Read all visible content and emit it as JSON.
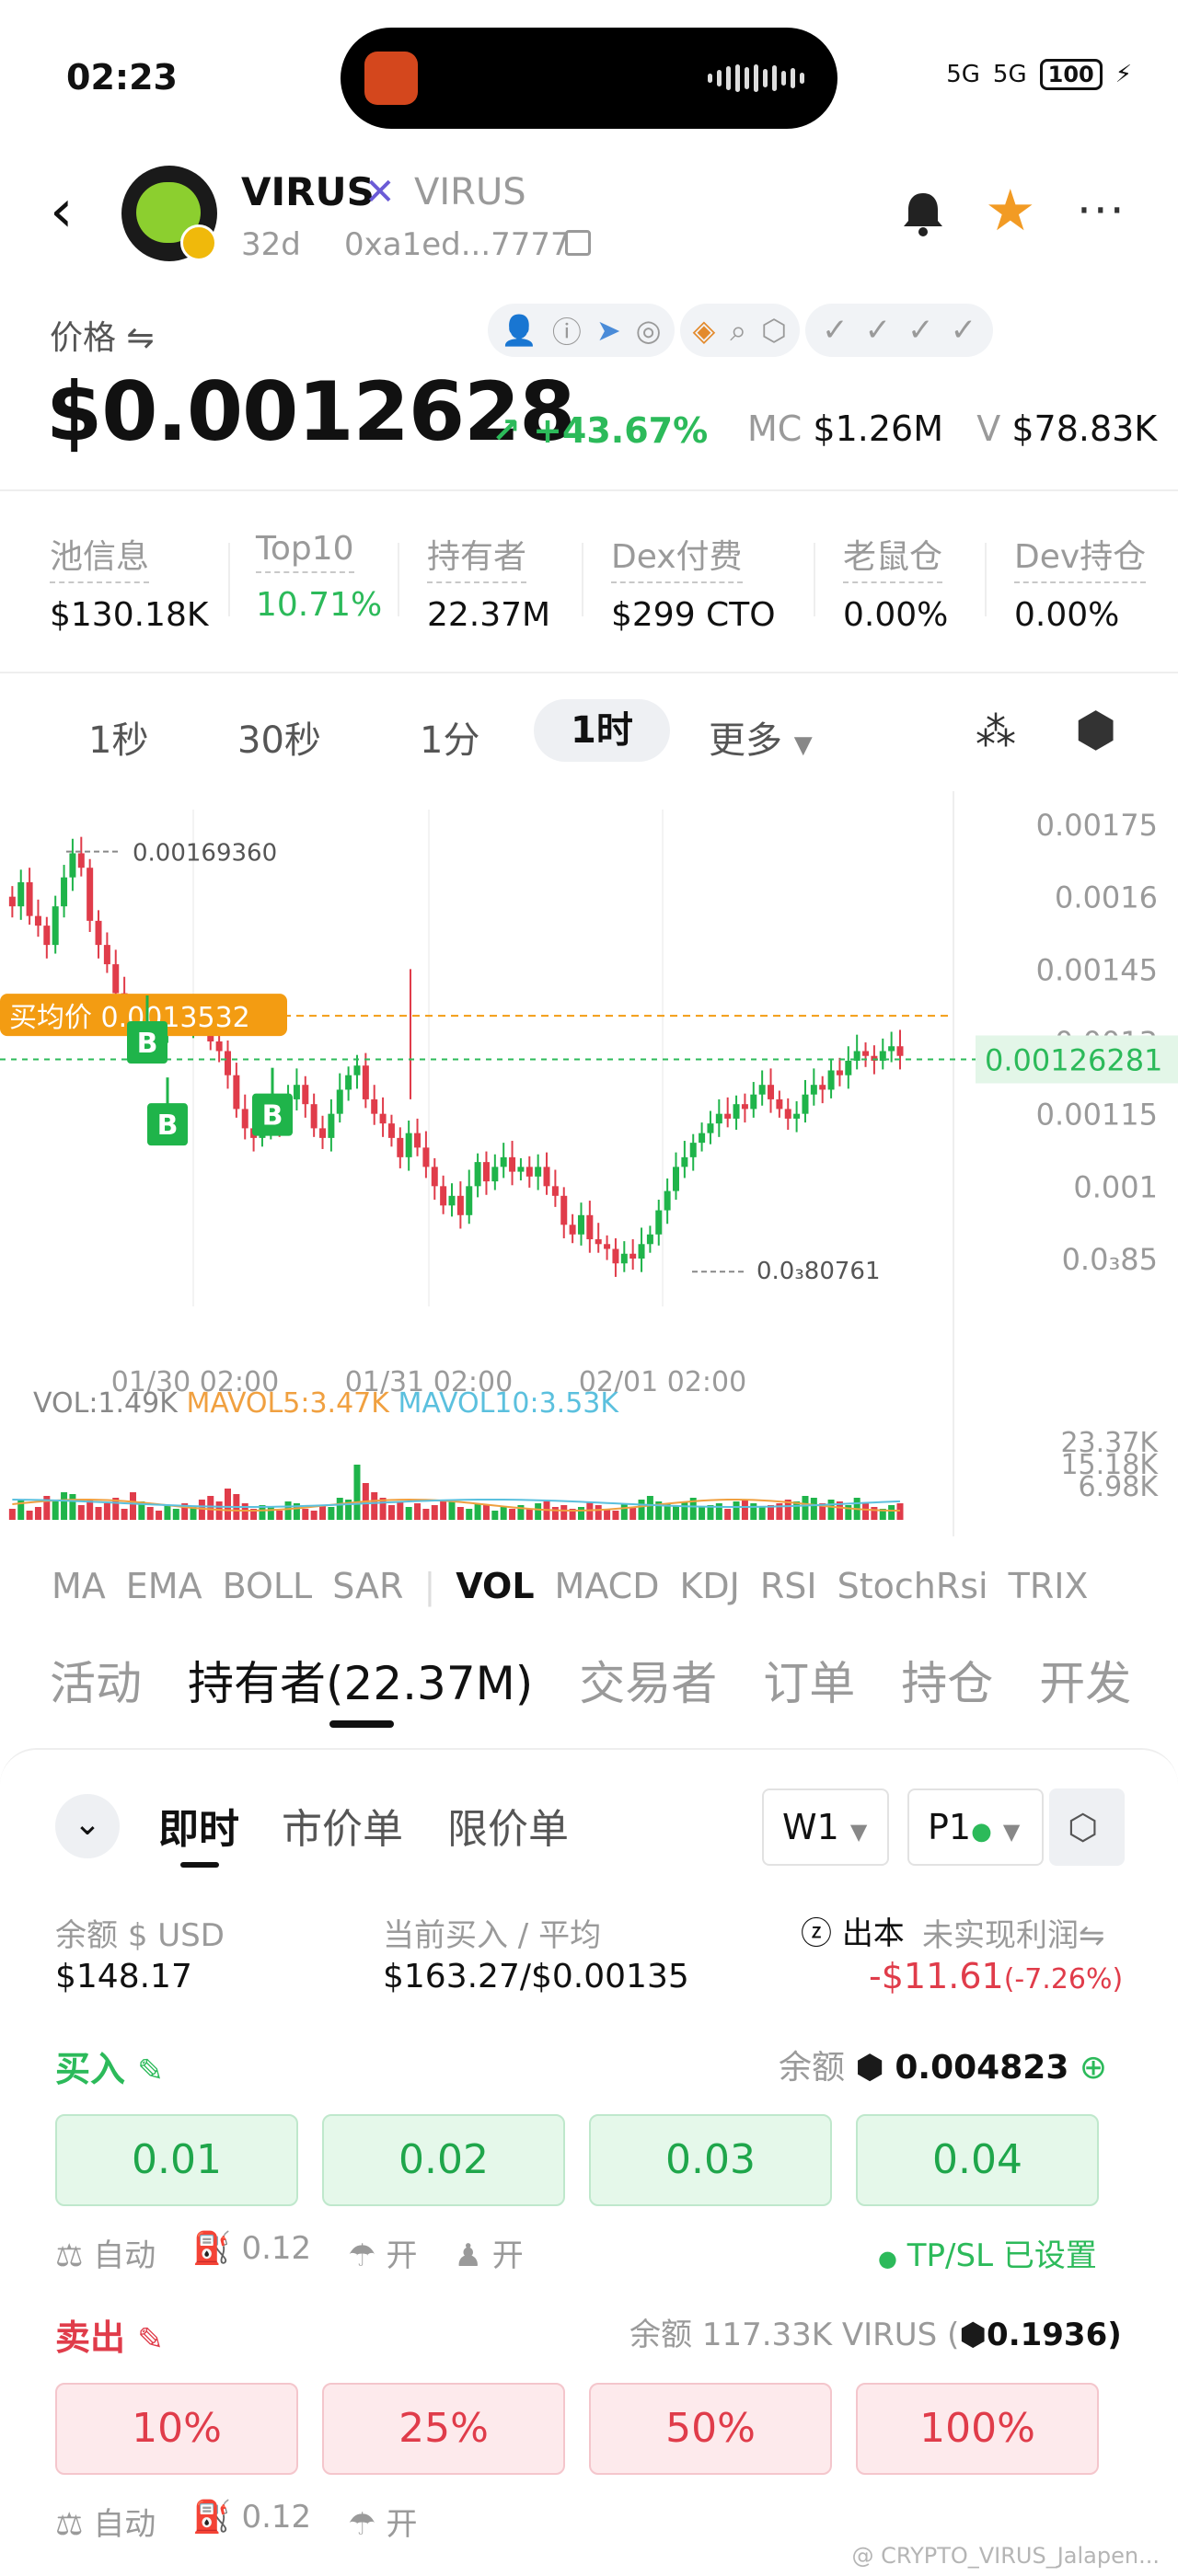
{
  "status": {
    "time": "02:23",
    "signal1": "5G",
    "signal2": "5G",
    "battery": "100"
  },
  "header": {
    "token_name": "VIRUS",
    "token_symbol": "VIRUS",
    "age": "32d",
    "address": "0xa1ed...7777"
  },
  "price": {
    "label": "价格 ⇋",
    "value": "$0.0012628",
    "change": "↗ +43.67%",
    "mc_label": "MC",
    "mc_value": "$1.26M",
    "v_label": "V",
    "v_value": "$78.83K"
  },
  "stats": [
    {
      "label": "池信息",
      "value": "$130.18K"
    },
    {
      "label": "Top10",
      "value": "10.71%"
    },
    {
      "label": "持有者",
      "value": "22.37M"
    },
    {
      "label": "Dex付费",
      "value": "$299 CTO"
    },
    {
      "label": "老鼠仓",
      "value": "0.00%"
    },
    {
      "label": "Dev持仓",
      "value": "0.00%"
    }
  ],
  "timeframes": {
    "s1": "1秒",
    "s30": "30秒",
    "m1": "1分",
    "h1": "1时",
    "more": "更多"
  },
  "chart": {
    "y_ticks": [
      "0.00175",
      "0.0016",
      "0.00145",
      "0.0013",
      "0.00115",
      "0.001",
      "0.0₃85"
    ],
    "x_ticks": [
      "01/30 02:00",
      "01/31 02:00",
      "02/01 02:00"
    ],
    "high_label": "0.00169360",
    "low_label": "0.0₃80761",
    "avg_label": "买均价 0.0013532",
    "current_label": "0.00126281",
    "vol_label": "VOL:1.49K",
    "mavol5_label": "MAVOL5:3.47K",
    "mavol10_label": "MAVOL10:3.53K",
    "vol_ticks": [
      "23.37K",
      "15.18K",
      "6.98K"
    ],
    "buy_marker": "B",
    "colors": {
      "up": "#1fb44a",
      "down": "#e03c4a",
      "avg": "#f39c12",
      "current": "#2cba5a",
      "ma5": "#f0a040",
      "ma10": "#5bc0de"
    }
  },
  "indicators": [
    "MA",
    "EMA",
    "BOLL",
    "SAR",
    "VOL",
    "MACD",
    "KDJ",
    "RSI",
    "StochRsi",
    "TRIX"
  ],
  "tabs": [
    "活动",
    "持有者(22.37M)",
    "交易者",
    "订单",
    "持仓",
    "开发"
  ],
  "trade": {
    "order_tabs": [
      "即时",
      "市价单",
      "限价单"
    ],
    "w_select": "W1",
    "p_select": "P1",
    "balance_label": "余额",
    "balance_unit": "USD",
    "balance_value": "$148.17",
    "current_buy_label": "当前买入 / 平均",
    "current_buy_value": "$163.27/$0.00135",
    "cost_label": "出本",
    "unrealized_label": "未实现利润⇋",
    "unrealized_value": "-$11.61",
    "unrealized_pct": "(-7.26%)",
    "buy_title": "买入",
    "buy_balance_label": "余额",
    "buy_balance_value": "0.004823",
    "buy_amounts": [
      "0.01",
      "0.02",
      "0.03",
      "0.04"
    ],
    "opt_auto": "自动",
    "opt_gas": "0.12",
    "opt_on1": "开",
    "opt_on2": "开",
    "tpsl": "TP/SL 已设置",
    "sell_title": "卖出",
    "sell_balance_label": "余额",
    "sell_balance_value": "117.33K VIRUS (",
    "sell_balance_bnb": "0.1936)",
    "sell_pcts": [
      "10%",
      "25%",
      "50%",
      "100%"
    ]
  },
  "watermark": "@ CRYPTO_VIRUS_Jalapen..."
}
